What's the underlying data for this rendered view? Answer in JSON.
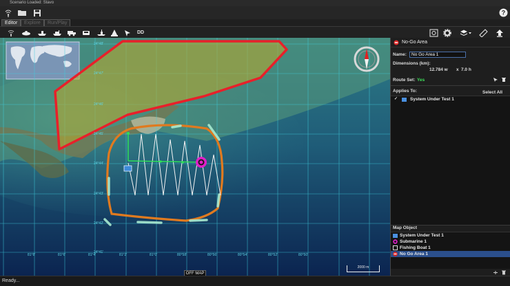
{
  "window": {
    "title": "Scenario Loaded: Stavo"
  },
  "toolbar": {
    "icons": [
      "wifi-icon",
      "folder-icon",
      "save-icon",
      "help-icon"
    ]
  },
  "tabs": [
    "Editor",
    "Explore",
    "Run/Play"
  ],
  "subtoolbar": {
    "tools": [
      "signal-icon",
      "submarine-icon",
      "ship-icon",
      "boat-icon",
      "truck-icon",
      "vehicle-icon",
      "flag-icon",
      "buoy-icon",
      "arrow-icon"
    ],
    "dd_label": "DD"
  },
  "map": {
    "grid_lat_labels": [
      "24°48'",
      "24°47'",
      "24°46'",
      "24°45'",
      "24°44'",
      "24°43'",
      "24°42'",
      "24°41'"
    ],
    "grid_lon_labels": [
      "81°8'",
      "81°6'",
      "81°4'",
      "81°2'",
      "81°0'",
      "80°58'",
      "80°56'",
      "80°54'",
      "80°52'",
      "80°50'"
    ],
    "off_map_label": "OFF MAP",
    "scale_label": "2000 m",
    "colors": {
      "no_go_fill": "#b5a830",
      "no_go_border": "#e8202a",
      "route_orange": "#e07a1f",
      "path_white": "#f4f4f4",
      "path_green": "#2ee05a",
      "grid": "#3fd0e0",
      "sea_deep": "#0f2f5c",
      "sea_shallow": "#2a7a8a",
      "marker_magenta": "#e020c8"
    }
  },
  "panel": {
    "header": "No-Go Area",
    "name_label": "Name:",
    "name_value": "No Go Area 1",
    "dimensions_label": "Dimensions (km):",
    "dim_w": "12.784 w",
    "dim_x": "x",
    "dim_h": "7.0 h",
    "route_set_label": "Route Set:",
    "route_set_value": "Yes",
    "applies_to_label": "Applies To:",
    "select_all_label": "Select All",
    "applies_items": [
      {
        "label": "System Under Test 1",
        "checked": true
      }
    ],
    "map_object_header": "Map Object",
    "map_objects": [
      {
        "label": "System Under Test 1",
        "icon": "system-icon"
      },
      {
        "label": "Submarine 1",
        "icon": "submarine-icon"
      },
      {
        "label": "Fishing Boat 1",
        "icon": "boat-icon"
      },
      {
        "label": "No Go Area 1",
        "icon": "no-go-icon",
        "selected": true
      }
    ]
  },
  "status": {
    "text": "Ready..."
  }
}
